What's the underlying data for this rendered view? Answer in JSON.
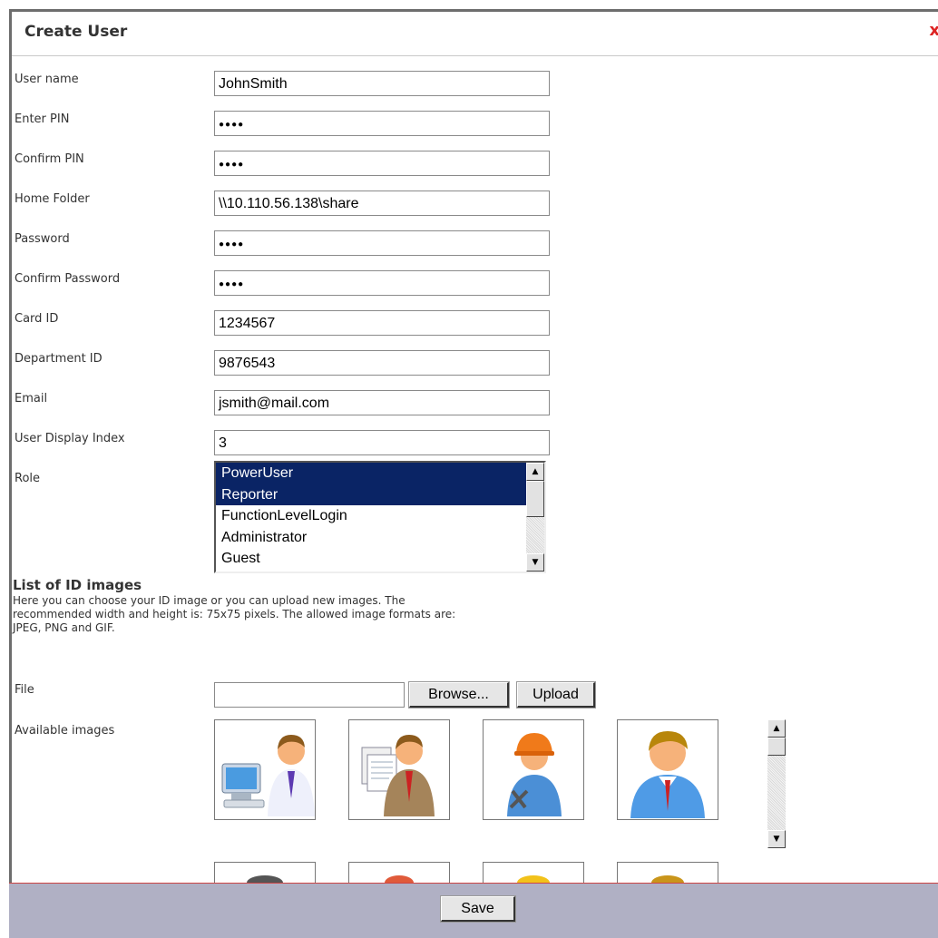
{
  "dialog": {
    "title": "Create User",
    "close_symbol": "x"
  },
  "fields": [
    {
      "label": "User name",
      "value": "JohnSmith",
      "masked": false
    },
    {
      "label": "Enter PIN",
      "value": "●●●●",
      "masked": true
    },
    {
      "label": "Confirm PIN",
      "value": "●●●●",
      "masked": true
    },
    {
      "label": "Home Folder",
      "value": "\\\\10.110.56.138\\share",
      "masked": false
    },
    {
      "label": "Password",
      "value": "●●●●",
      "masked": true
    },
    {
      "label": "Confirm Password",
      "value": "●●●●",
      "masked": true
    },
    {
      "label": "Card ID",
      "value": "1234567",
      "masked": false
    },
    {
      "label": "Department ID",
      "value": "9876543",
      "masked": false
    },
    {
      "label": "Email",
      "value": "jsmith@mail.com",
      "masked": false
    },
    {
      "label": "User Display Index",
      "value": "3",
      "masked": false
    }
  ],
  "role": {
    "label": "Role",
    "options": [
      {
        "label": "PowerUser",
        "selected": true
      },
      {
        "label": "Reporter",
        "selected": true
      },
      {
        "label": "FunctionLevelLogin",
        "selected": false
      },
      {
        "label": "Administrator",
        "selected": false
      },
      {
        "label": "Guest",
        "selected": false
      }
    ]
  },
  "id_images": {
    "heading": "List of ID images",
    "description_lines": [
      "Here you can choose your ID image or you can upload new images. The",
      "recommended width and height is: 75x75 pixels. The allowed image formats are:",
      "JPEG, PNG and GIF."
    ],
    "file_label": "File",
    "file_value": "",
    "browse_label": "Browse...",
    "upload_label": "Upload",
    "available_label": "Available images",
    "images": [
      "user-computer-icon",
      "user-documents-icon",
      "user-worker-icon",
      "user-businessman-icon"
    ],
    "next_row": [
      "user-dark-hair-icon",
      "user-red-hair-icon",
      "user-yellow-hair-icon",
      "user-brown-hair-icon"
    ]
  },
  "footer": {
    "save_label": "Save"
  },
  "colors": {
    "selection": "#0a2465",
    "footer_bg": "#b0b0c4",
    "close": "#dd2222"
  }
}
